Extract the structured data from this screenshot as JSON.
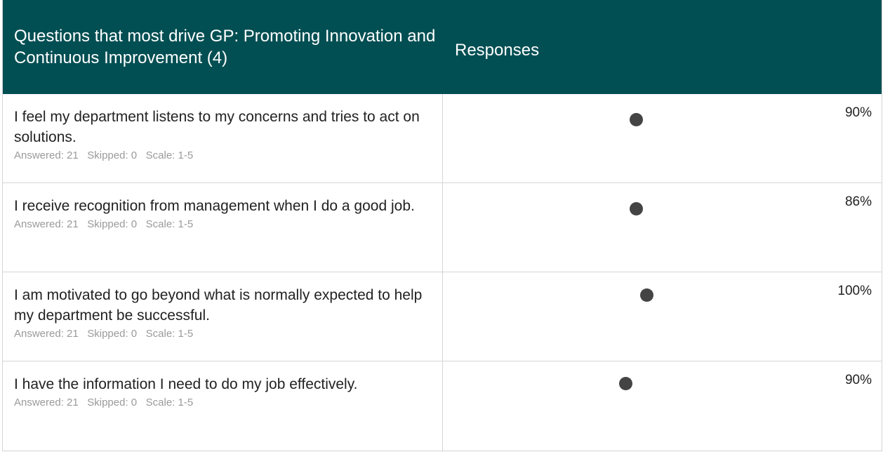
{
  "header": {
    "question_title": "Questions that most drive GP: Promoting Innovation and Continuous Improvement (4)",
    "responses_title": "Responses"
  },
  "rows": [
    {
      "question": "I feel my department listens to my concerns and tries to act on solutions.",
      "answered": "Answered: 21",
      "skipped": "Skipped: 0",
      "scale": "Scale: 1-5",
      "percent": "90%",
      "value": 90
    },
    {
      "question": "I receive recognition from management when I do a good job.",
      "answered": "Answered: 21",
      "skipped": "Skipped: 0",
      "scale": "Scale: 1-5",
      "percent": "86%",
      "value": 86
    },
    {
      "question": "I am motivated to go beyond what is normally expected to help my department be successful.",
      "answered": "Answered: 21",
      "skipped": "Skipped: 0",
      "scale": "Scale: 1-5",
      "percent": "100%",
      "value": 100
    },
    {
      "question": "I have the information I need to do my job effectively.",
      "answered": "Answered: 21",
      "skipped": "Skipped: 0",
      "scale": "Scale: 1-5",
      "percent": "90%",
      "value": 90
    }
  ],
  "colors": {
    "header_bg": "#024f53",
    "dot": "#444444",
    "meta_text": "#9a9a9a"
  }
}
